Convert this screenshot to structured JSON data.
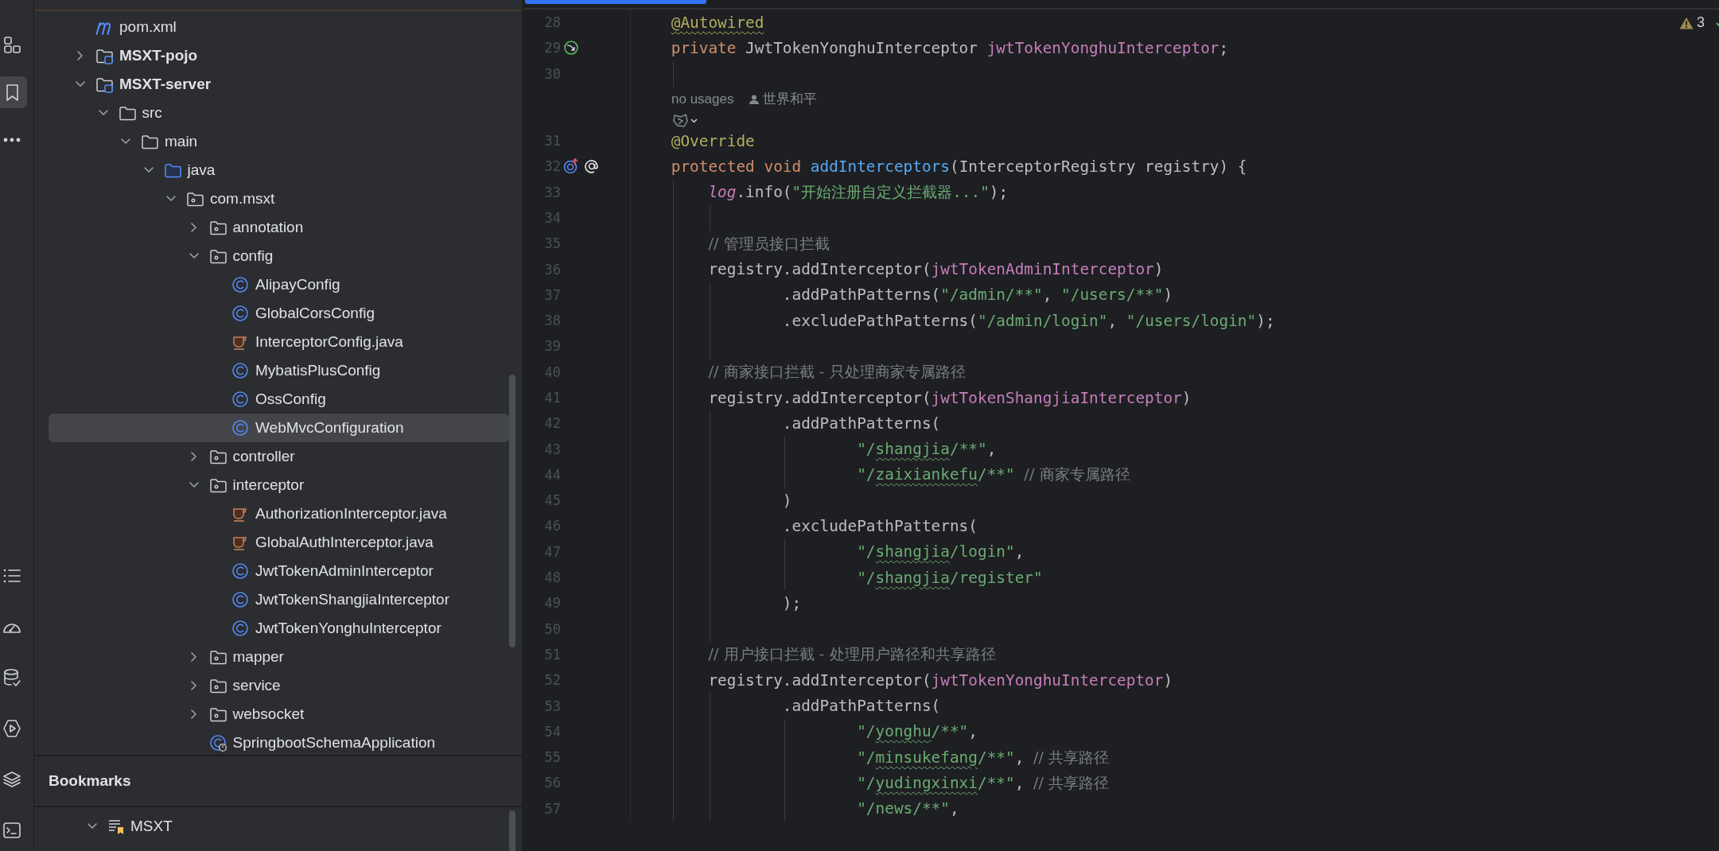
{
  "tool_strip": {
    "top": [
      {
        "kind": "plugins",
        "selected": false
      },
      {
        "kind": "bookmarks",
        "selected": true
      },
      {
        "kind": "more",
        "selected": false
      }
    ],
    "bottom": [
      {
        "kind": "structure",
        "selected": false
      },
      {
        "kind": "profiler",
        "selected": false
      },
      {
        "kind": "database",
        "selected": false
      },
      {
        "kind": "services",
        "selected": false
      },
      {
        "kind": "layers",
        "selected": false
      },
      {
        "kind": "terminal",
        "selected": false
      }
    ]
  },
  "project_tree": [
    {
      "label": "pom.xml",
      "kind": "maven-file",
      "selected": false
    },
    {
      "label": "MSXT-pojo",
      "kind": "module",
      "expanded": false,
      "selected": false
    },
    {
      "label": "MSXT-server",
      "kind": "module",
      "expanded": true,
      "selected": false,
      "children": [
        {
          "label": "src",
          "kind": "folder",
          "expanded": true,
          "selected": false,
          "children": [
            {
              "label": "main",
              "kind": "folder",
              "expanded": true,
              "selected": false,
              "children": [
                {
                  "label": "java",
                  "kind": "source-folder",
                  "expanded": true,
                  "selected": false,
                  "children": [
                    {
                      "label": "com.msxt",
                      "kind": "package",
                      "expanded": true,
                      "selected": false,
                      "children": [
                        {
                          "label": "annotation",
                          "kind": "package",
                          "expanded": false,
                          "selected": false
                        },
                        {
                          "label": "config",
                          "kind": "package",
                          "expanded": true,
                          "selected": false,
                          "children": [
                            {
                              "label": "AlipayConfig",
                              "kind": "class",
                              "selected": false
                            },
                            {
                              "label": "GlobalCorsConfig",
                              "kind": "class",
                              "selected": false
                            },
                            {
                              "label": "InterceptorConfig.java",
                              "kind": "java-file",
                              "selected": false
                            },
                            {
                              "label": "MybatisPlusConfig",
                              "kind": "class",
                              "selected": false
                            },
                            {
                              "label": "OssConfig",
                              "kind": "class",
                              "selected": false
                            },
                            {
                              "label": "WebMvcConfiguration",
                              "kind": "class",
                              "selected": true
                            }
                          ]
                        },
                        {
                          "label": "controller",
                          "kind": "package",
                          "expanded": false,
                          "selected": false
                        },
                        {
                          "label": "interceptor",
                          "kind": "package",
                          "expanded": true,
                          "selected": false,
                          "children": [
                            {
                              "label": "AuthorizationInterceptor.java",
                              "kind": "java-file",
                              "selected": false
                            },
                            {
                              "label": "GlobalAuthInterceptor.java",
                              "kind": "java-file",
                              "selected": false
                            },
                            {
                              "label": "JwtTokenAdminInterceptor",
                              "kind": "class",
                              "selected": false
                            },
                            {
                              "label": "JwtTokenShangjiaInterceptor",
                              "kind": "class",
                              "selected": false
                            },
                            {
                              "label": "JwtTokenYonghuInterceptor",
                              "kind": "class",
                              "selected": false
                            }
                          ]
                        },
                        {
                          "label": "mapper",
                          "kind": "package",
                          "expanded": false,
                          "selected": false
                        },
                        {
                          "label": "service",
                          "kind": "package",
                          "expanded": false,
                          "selected": false
                        },
                        {
                          "label": "websocket",
                          "kind": "package",
                          "expanded": false,
                          "selected": false
                        },
                        {
                          "label": "SpringbootSchemaApplication",
                          "kind": "app-class",
                          "selected": false
                        }
                      ]
                    }
                  ]
                }
              ]
            }
          ]
        }
      ]
    }
  ],
  "bookmarks": {
    "title": "Bookmarks",
    "lists": [
      {
        "label": "MSXT",
        "expanded": true
      }
    ]
  },
  "editor": {
    "warnings": "3",
    "lines": [
      {
        "kind": "code",
        "number": "28",
        "tokens": [
          {
            "text": "    @Autowired",
            "kind": "annotation-typo"
          }
        ]
      },
      {
        "kind": "code",
        "number": "29",
        "gutter_icons": [
          {
            "kind": "bean"
          }
        ],
        "tokens": [
          {
            "text": "    private",
            "kind": "keyword"
          },
          {
            "text": " JwtTokenYonghuInterceptor ",
            "kind": "plain"
          },
          {
            "text": "jwtTokenYonghuInterceptor",
            "kind": "field"
          },
          {
            "text": ";",
            "kind": "plain"
          }
        ]
      },
      {
        "kind": "code",
        "number": "30"
      },
      {
        "kind": "inlay",
        "usages": "no usages",
        "author": "世界和平"
      },
      {
        "kind": "code",
        "number": "31",
        "tokens": [
          {
            "text": "    @Override",
            "kind": "annotation"
          }
        ]
      },
      {
        "kind": "code",
        "number": "32",
        "gutter_icons": [
          {
            "kind": "override"
          },
          {
            "kind": "at"
          }
        ],
        "tokens": [
          {
            "text": "    protected ",
            "kind": "keyword"
          },
          {
            "text": "void ",
            "kind": "keyword"
          },
          {
            "text": "addInterceptors",
            "kind": "method"
          },
          {
            "text": "(InterceptorRegistry registry) {",
            "kind": "plain"
          }
        ]
      },
      {
        "kind": "code",
        "number": "33",
        "tokens": [
          {
            "text": "        log",
            "kind": "static-field"
          },
          {
            "text": ".info(",
            "kind": "plain"
          },
          {
            "text": "\"开始注册自定义拦截器...\"",
            "kind": "string"
          },
          {
            "text": ");",
            "kind": "plain"
          }
        ]
      },
      {
        "kind": "code",
        "number": "34"
      },
      {
        "kind": "code",
        "number": "35",
        "tokens": [
          {
            "text": "        // 管理员接口拦截",
            "kind": "comment"
          }
        ]
      },
      {
        "kind": "code",
        "number": "36",
        "tokens": [
          {
            "text": "        registry.addInterceptor(",
            "kind": "plain"
          },
          {
            "text": "jwtTokenAdminInterceptor",
            "kind": "field"
          },
          {
            "text": ")",
            "kind": "plain"
          }
        ]
      },
      {
        "kind": "code",
        "number": "37",
        "tokens": [
          {
            "text": "                .addPathPatterns(",
            "kind": "plain"
          },
          {
            "text": "\"/admin/**\"",
            "kind": "string"
          },
          {
            "text": ", ",
            "kind": "plain"
          },
          {
            "text": "\"/users/**\"",
            "kind": "string"
          },
          {
            "text": ")",
            "kind": "plain"
          }
        ]
      },
      {
        "kind": "code",
        "number": "38",
        "tokens": [
          {
            "text": "                .excludePathPatterns(",
            "kind": "plain"
          },
          {
            "text": "\"/admin/login\"",
            "kind": "string"
          },
          {
            "text": ", ",
            "kind": "plain"
          },
          {
            "text": "\"/users/login\"",
            "kind": "string"
          },
          {
            "text": ");",
            "kind": "plain"
          }
        ]
      },
      {
        "kind": "code",
        "number": "39"
      },
      {
        "kind": "code",
        "number": "40",
        "tokens": [
          {
            "text": "        // 商家接口拦截 - 只处理商家专属路径",
            "kind": "comment"
          }
        ]
      },
      {
        "kind": "code",
        "number": "41",
        "tokens": [
          {
            "text": "        registry.addInterceptor(",
            "kind": "plain"
          },
          {
            "text": "jwtTokenShangjiaInterceptor",
            "kind": "field"
          },
          {
            "text": ")",
            "kind": "plain"
          }
        ]
      },
      {
        "kind": "code",
        "number": "42",
        "tokens": [
          {
            "text": "                .addPathPatterns(",
            "kind": "plain"
          }
        ]
      },
      {
        "kind": "code",
        "number": "43",
        "tokens": [
          {
            "text": "                        \"/",
            "kind": "string"
          },
          {
            "text": "shangjia",
            "kind": "string-typo"
          },
          {
            "text": "/**\"",
            "kind": "string"
          },
          {
            "text": ",",
            "kind": "plain"
          }
        ]
      },
      {
        "kind": "code",
        "number": "44",
        "tokens": [
          {
            "text": "                        \"/",
            "kind": "string"
          },
          {
            "text": "zaixiankefu",
            "kind": "string-typo"
          },
          {
            "text": "/**\" ",
            "kind": "string"
          },
          {
            "text": "// 商家专属路径",
            "kind": "comment"
          }
        ]
      },
      {
        "kind": "code",
        "number": "45",
        "tokens": [
          {
            "text": "                )",
            "kind": "plain"
          }
        ]
      },
      {
        "kind": "code",
        "number": "46",
        "tokens": [
          {
            "text": "                .excludePathPatterns(",
            "kind": "plain"
          }
        ]
      },
      {
        "kind": "code",
        "number": "47",
        "tokens": [
          {
            "text": "                        \"/",
            "kind": "string"
          },
          {
            "text": "shangjia",
            "kind": "string-typo"
          },
          {
            "text": "/login\"",
            "kind": "string"
          },
          {
            "text": ",",
            "kind": "plain"
          }
        ]
      },
      {
        "kind": "code",
        "number": "48",
        "tokens": [
          {
            "text": "                        \"/",
            "kind": "string"
          },
          {
            "text": "shangjia",
            "kind": "string-typo"
          },
          {
            "text": "/register\"",
            "kind": "string"
          }
        ]
      },
      {
        "kind": "code",
        "number": "49",
        "tokens": [
          {
            "text": "                );",
            "kind": "plain"
          }
        ]
      },
      {
        "kind": "code",
        "number": "50"
      },
      {
        "kind": "code",
        "number": "51",
        "tokens": [
          {
            "text": "        // 用户接口拦截 - 处理用户路径和共享路径",
            "kind": "comment"
          }
        ]
      },
      {
        "kind": "code",
        "number": "52",
        "tokens": [
          {
            "text": "        registry.addInterceptor(",
            "kind": "plain"
          },
          {
            "text": "jwtTokenYonghuInterceptor",
            "kind": "field"
          },
          {
            "text": ")",
            "kind": "plain"
          }
        ]
      },
      {
        "kind": "code",
        "number": "53",
        "tokens": [
          {
            "text": "                .addPathPatterns(",
            "kind": "plain"
          }
        ]
      },
      {
        "kind": "code",
        "number": "54",
        "tokens": [
          {
            "text": "                        \"/",
            "kind": "string"
          },
          {
            "text": "yonghu",
            "kind": "string-typo"
          },
          {
            "text": "/**\"",
            "kind": "string"
          },
          {
            "text": ",",
            "kind": "plain"
          }
        ]
      },
      {
        "kind": "code",
        "number": "55",
        "tokens": [
          {
            "text": "                        \"/",
            "kind": "string"
          },
          {
            "text": "minsukefang",
            "kind": "string-typo"
          },
          {
            "text": "/**\"",
            "kind": "string"
          },
          {
            "text": ", ",
            "kind": "plain"
          },
          {
            "text": "// 共享路径",
            "kind": "comment"
          }
        ]
      },
      {
        "kind": "code",
        "number": "56",
        "tokens": [
          {
            "text": "                        \"/",
            "kind": "string"
          },
          {
            "text": "yudingxinxi",
            "kind": "string-typo"
          },
          {
            "text": "/**\"",
            "kind": "string"
          },
          {
            "text": ", ",
            "kind": "plain"
          },
          {
            "text": "// 共享路径",
            "kind": "comment"
          }
        ]
      },
      {
        "kind": "code",
        "number": "57",
        "tokens": [
          {
            "text": "                        \"/news/**\"",
            "kind": "string"
          },
          {
            "text": ",",
            "kind": "plain"
          }
        ]
      }
    ]
  }
}
